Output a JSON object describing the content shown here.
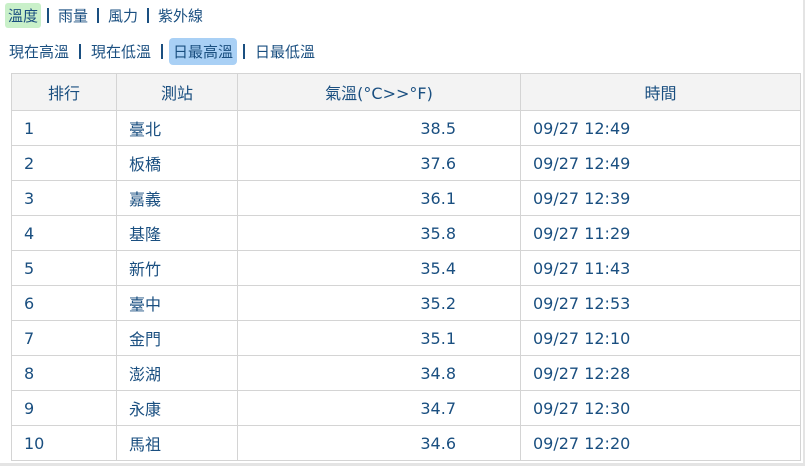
{
  "tabs": [
    {
      "label": "溫度",
      "active": true
    },
    {
      "label": "雨量",
      "active": false
    },
    {
      "label": "風力",
      "active": false
    },
    {
      "label": "紫外線",
      "active": false
    }
  ],
  "subtabs": [
    {
      "label": "現在高溫",
      "active": false
    },
    {
      "label": "現在低溫",
      "active": false
    },
    {
      "label": "日最高溫",
      "active": true
    },
    {
      "label": "日最低溫",
      "active": false
    }
  ],
  "table": {
    "headers": [
      "排行",
      "測站",
      "氣溫(°C>>°F)",
      "時間"
    ],
    "rows": [
      {
        "rank": "1",
        "station": "臺北",
        "temp": "38.5",
        "time": "09/27 12:49"
      },
      {
        "rank": "2",
        "station": "板橋",
        "temp": "37.6",
        "time": "09/27 12:49"
      },
      {
        "rank": "3",
        "station": "嘉義",
        "temp": "36.1",
        "time": "09/27 12:39"
      },
      {
        "rank": "4",
        "station": "基隆",
        "temp": "35.8",
        "time": "09/27 11:29"
      },
      {
        "rank": "5",
        "station": "新竹",
        "temp": "35.4",
        "time": "09/27 11:43"
      },
      {
        "rank": "6",
        "station": "臺中",
        "temp": "35.2",
        "time": "09/27 12:53"
      },
      {
        "rank": "7",
        "station": "金門",
        "temp": "35.1",
        "time": "09/27 12:10"
      },
      {
        "rank": "8",
        "station": "澎湖",
        "temp": "34.8",
        "time": "09/27 12:28"
      },
      {
        "rank": "9",
        "station": "永康",
        "temp": "34.7",
        "time": "09/27 12:30"
      },
      {
        "rank": "10",
        "station": "馬祖",
        "temp": "34.6",
        "time": "09/27 12:20"
      }
    ]
  },
  "colors": {
    "text": "#1a4f80",
    "active_tab": "#c9f0c9",
    "active_subtab": "#a9d0f5",
    "header_bg": "#f3f3f3"
  }
}
